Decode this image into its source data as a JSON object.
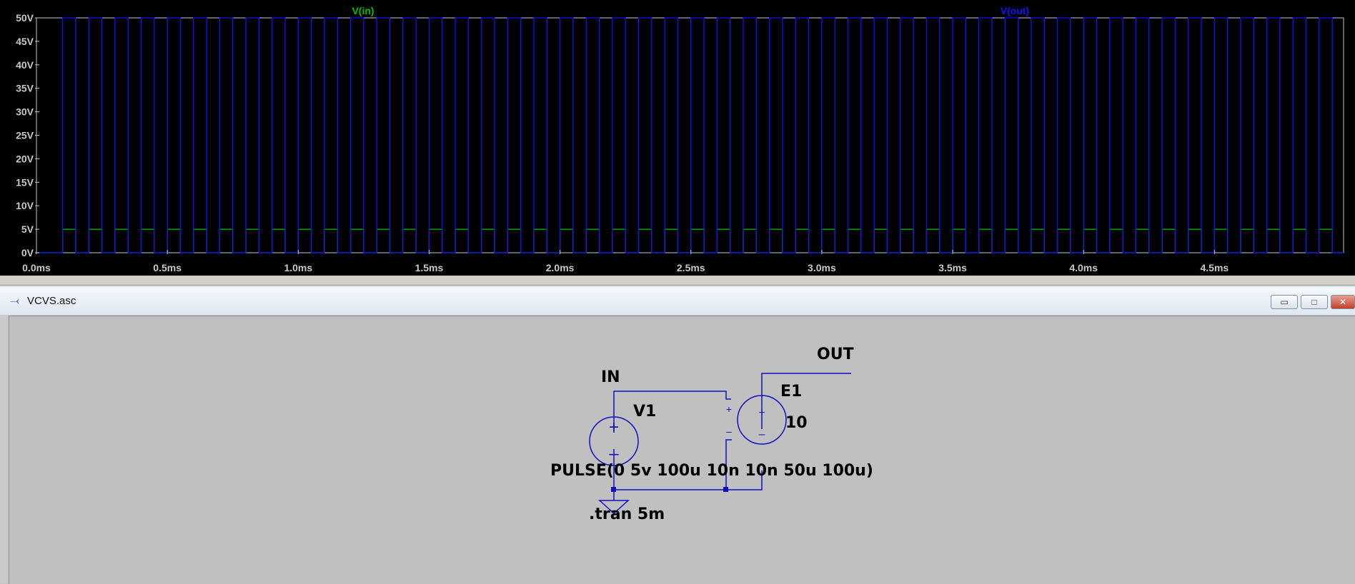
{
  "plot": {
    "traces": [
      {
        "name": "V(in)",
        "color": "#00c000"
      },
      {
        "name": "V(out)",
        "color": "#1010ff"
      }
    ],
    "y_ticks": [
      "0V",
      "5V",
      "10V",
      "15V",
      "20V",
      "25V",
      "30V",
      "35V",
      "40V",
      "45V",
      "50V"
    ],
    "x_ticks": [
      "0.0ms",
      "0.5ms",
      "1.0ms",
      "1.5ms",
      "2.0ms",
      "2.5ms",
      "3.0ms",
      "3.5ms",
      "4.0ms",
      "4.5ms"
    ],
    "colors": {
      "background": "#000000",
      "frame": "#c8c8c8",
      "tick_text": "#c8c8c8"
    }
  },
  "chart_data": {
    "type": "line",
    "xlabel": "",
    "ylabel": "",
    "xlim": [
      0,
      5.0
    ],
    "ylim": [
      0,
      50
    ],
    "x_units": "ms",
    "y_units": "V",
    "grid": false,
    "legend": "top",
    "pulse": {
      "delay_ms": 0.1,
      "period_ms": 0.1,
      "width_ms": 0.05
    },
    "series": [
      {
        "name": "V(in)",
        "low": 0,
        "high": 5,
        "color": "#00c000"
      },
      {
        "name": "V(out)",
        "low": 0,
        "high": 50,
        "color": "#1010ff"
      }
    ]
  },
  "schematic_window": {
    "title": "VCVS.asc",
    "buttons": {
      "minimize": "▭",
      "maximize": "□",
      "close": "✕"
    }
  },
  "schematic": {
    "net_in": "IN",
    "net_out": "OUT",
    "source_name": "V1",
    "source_value": "PULSE(0 5v 100u 10n 10n 50u 100u)",
    "vcvs_name": "E1",
    "vcvs_gain": "10",
    "directive": ".tran 5m",
    "plus": "+",
    "minus": "–",
    "colors": {
      "wire": "#1010c0",
      "junction": "#1010c0"
    }
  }
}
